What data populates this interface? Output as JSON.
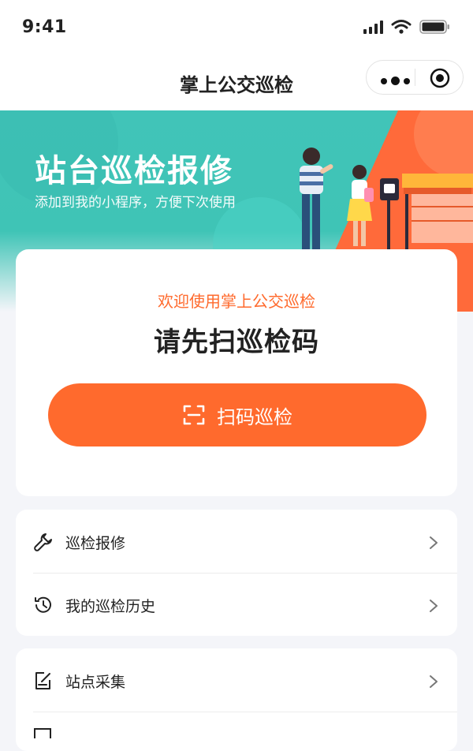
{
  "status_bar": {
    "time": "9:41"
  },
  "nav": {
    "title": "掌上公交巡检"
  },
  "banner": {
    "title": "站台巡检报修",
    "subtitle": "添加到我的小程序，方便下次使用"
  },
  "scan_card": {
    "welcome": "欢迎使用掌上公交巡检",
    "prompt": "请先扫巡检码",
    "button_label": "扫码巡检"
  },
  "menu_group_1": [
    {
      "label": "巡检报修",
      "icon": "wrench-icon"
    },
    {
      "label": "我的巡检历史",
      "icon": "history-clock-icon"
    }
  ],
  "menu_group_2": [
    {
      "label": "站点采集",
      "icon": "edit-note-icon"
    }
  ],
  "colors": {
    "accent": "#ff6a2d",
    "teal": "#41c4b8",
    "background": "#f4f5f9"
  }
}
